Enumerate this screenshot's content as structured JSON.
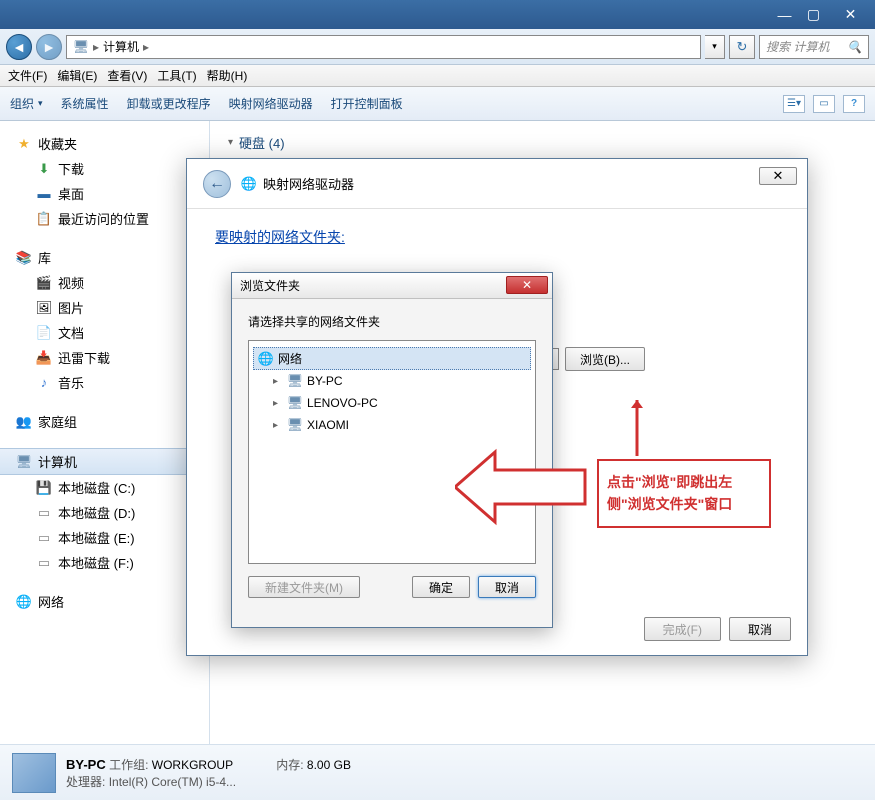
{
  "titlebar": {
    "min": "—",
    "max": "▢",
    "close": "✕"
  },
  "address": {
    "computer_icon": "🖥",
    "path1": "计算机",
    "triangle": "▸",
    "dropdown": "▾",
    "refresh": "↻",
    "search_placeholder": "搜索 计算机",
    "search_icon": "🔍"
  },
  "menu": {
    "file": "文件(F)",
    "edit": "编辑(E)",
    "view": "查看(V)",
    "tools": "工具(T)",
    "help": "帮助(H)"
  },
  "toolbar": {
    "organize": "组织",
    "org_arrow": "▾",
    "props": "系统属性",
    "uninstall": "卸载或更改程序",
    "map_drive": "映射网络驱动器",
    "ctrl_panel": "打开控制面板",
    "help_icon": "?"
  },
  "sidebar": {
    "fav": {
      "label": "收藏夹",
      "downloads": "下载",
      "desktop": "桌面",
      "recent": "最近访问的位置"
    },
    "lib": {
      "label": "库",
      "videos": "视频",
      "pictures": "图片",
      "docs": "文档",
      "xunlei": "迅雷下载",
      "music": "音乐"
    },
    "homegroup": "家庭组",
    "computer": {
      "label": "计算机",
      "c": "本地磁盘 (C:)",
      "d": "本地磁盘 (D:)",
      "e": "本地磁盘 (E:)",
      "f": "本地磁盘 (F:)"
    },
    "network": "网络"
  },
  "main": {
    "section_arrow": "▾",
    "section": "硬盘 (4)"
  },
  "map_dialog": {
    "back": "←",
    "icon": "🌐",
    "title": "映射网络驱动器",
    "close": "✕",
    "link": "要映射的网络文件夹:",
    "combo_arrow": "▾",
    "browse": "浏览(B)...",
    "finish": "完成(F)",
    "cancel": "取消"
  },
  "browse_dialog": {
    "title": "浏览文件夹",
    "close": "✕",
    "message": "请选择共享的网络文件夹",
    "root_icon": "🌐",
    "root": "网络",
    "items": [
      {
        "exp": "▸",
        "icon": "🖥",
        "label": "BY-PC"
      },
      {
        "exp": "▸",
        "icon": "🖥",
        "label": "LENOVO-PC"
      },
      {
        "exp": "▸",
        "icon": "🖥",
        "label": "XIAOMI"
      }
    ],
    "new_folder": "新建文件夹(M)",
    "ok": "确定",
    "cancel": "取消"
  },
  "annotation": {
    "text": "点击\"浏览\"即跳出左侧\"浏览文件夹\"窗口"
  },
  "details": {
    "name": "BY-PC",
    "workgroup_label": "工作组:",
    "workgroup": "WORKGROUP",
    "cpu_label": "处理器:",
    "cpu": "Intel(R) Core(TM) i5-4...",
    "mem_label": "内存:",
    "mem": "8.00 GB"
  }
}
